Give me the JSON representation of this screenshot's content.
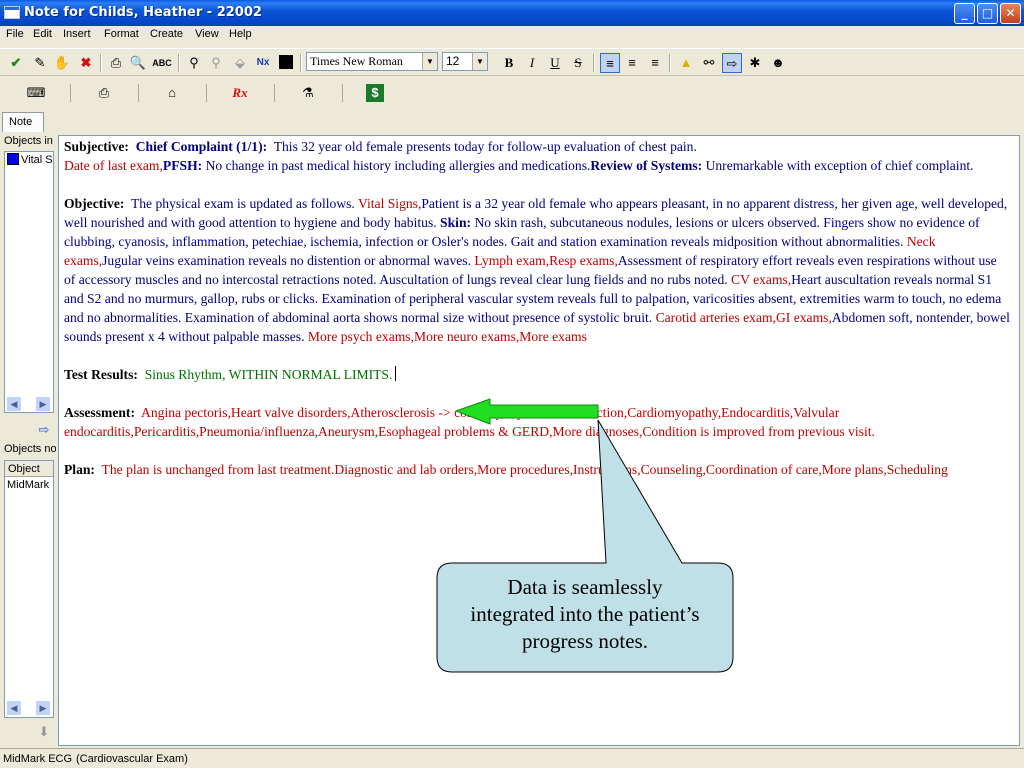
{
  "window": {
    "title": "Note for Childs, Heather - 22002"
  },
  "menu": [
    "File",
    "Edit",
    "Insert",
    "Format",
    "Create",
    "View",
    "Help"
  ],
  "toolbar": {
    "font": "Times New Roman",
    "size": "12"
  },
  "toolbar2_labels": {
    "rx": "Rx"
  },
  "left_panel": {
    "tab": "Note",
    "objects_in_label": "Objects in Note",
    "objects_in_items": [
      "Vital Signs"
    ],
    "objects_not_label": "Objects not in Note",
    "column_header": "Object",
    "objects_not_items": [
      "MidMark ECG"
    ]
  },
  "note": {
    "subjective": {
      "label": "Subjective:",
      "cc_label": "Chief Complaint (1/1):",
      "cc_text": "This 32 year old female presents today for follow-up evaluation of chest pain.",
      "date_last_exam": "Date of last exam,",
      "pfsh_label": "PFSH:",
      "pfsh_text": "No change in past medical history including allergies and medications.",
      "ros_label": "Review of Systems:",
      "ros_text": "Unremarkable with exception of chief complaint."
    },
    "objective": {
      "label": "Objective:",
      "t1": "The physical exam is updated as follows.",
      "vital_signs": "Vital Signs,",
      "t2": "Patient is a 32 year old female who appears pleasant, in no apparent distress, her given age, well developed, well nourished and with good attention to hygiene and body habitus.",
      "skin_label": "Skin:",
      "t3": "No skin rash, subcutaneous nodules, lesions or ulcers observed. Fingers show no evidence of clubbing, cyanosis, inflammation, petechiae, ischemia, infection or Osler's nodes. Gait and station examination reveals midposition without abnormalities.",
      "neck_exams": "Neck exams,",
      "t4": "Jugular veins examination reveals no distention or abnormal waves.",
      "lymph_resp": "Lymph exam,Resp exams,",
      "t5": "Assessment of respiratory effort reveals even respirations without use of accessory muscles and no intercostal retractions noted. Auscultation of lungs reveal clear lung fields and no rubs noted.",
      "cv_exams": "CV exams,",
      "t6": "Heart auscultation reveals normal S1 and S2 and no murmurs, gallop, rubs or clicks. Examination of peripheral vascular system reveals full to palpation, varicosities absent, extremities warm to touch, no edema and no abnormalities. Examination of abdominal aorta shows normal size without presence of systolic bruit.",
      "carotid_gi": "Carotid arteries exam,GI exams,",
      "t7": "Abdomen soft, nontender, bowel sounds present x 4 without palpable masses.",
      "more": "More psych exams,More neuro exams,More exams"
    },
    "test_results": {
      "label": "Test Results:",
      "text": "Sinus Rhythm, WITHIN NORMAL LIMITS."
    },
    "assessment": {
      "label": "Assessment:",
      "text": "Angina pectoris,Heart valve disorders,Atherosclerosis -> coronary,Myocardial infarction,Cardiomyopathy,Endocarditis,Valvular endocarditis,Pericarditis,Pneumonia/influenza,Aneurysm,Esophageal problems & GERD,More diagnoses,Condition is improved from previous visit."
    },
    "plan": {
      "label": "Plan:",
      "text": "The plan is unchanged from last treatment.Diagnostic and lab orders,More procedures,Instructions,Counseling,Coordination of care,More plans,Scheduling"
    }
  },
  "callout": {
    "line1": "Data is seamlessly",
    "line2": "integrated into the patient’s",
    "line3": "progress notes."
  },
  "status": {
    "left": "MidMark ECG",
    "right": "(Cardiovascular Exam)"
  },
  "colors": {
    "accent_blue": "#0a5be0",
    "note_blue": "#000080",
    "note_red": "#c00000",
    "note_green": "#007000",
    "callout_fill": "#bfe0e6",
    "arrow_green": "#22dd22"
  }
}
